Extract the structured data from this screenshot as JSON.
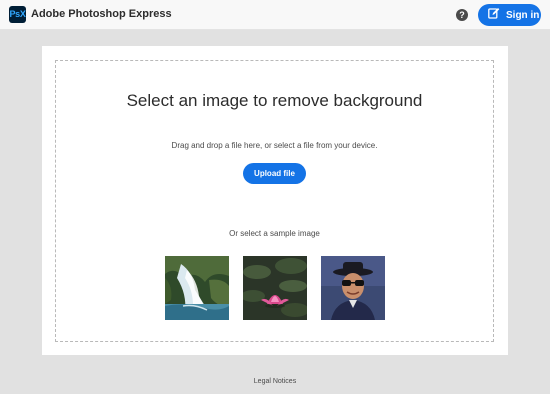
{
  "header": {
    "logo_text": "PsX",
    "app_title": "Adobe Photoshop Express",
    "help_glyph": "?",
    "help_icon": "help-icon",
    "signin_icon": "signin-icon",
    "signin_label": "Sign in"
  },
  "main": {
    "heading": "Select an image to remove background",
    "subtext": "Drag and drop a file here, or select a file from your device.",
    "upload_label": "Upload file",
    "sample_label": "Or select a sample image",
    "samples": [
      {
        "subject": "waterfall"
      },
      {
        "subject": "pink lotus flower"
      },
      {
        "subject": "man with sunglasses and hat"
      }
    ]
  },
  "footer": {
    "legal_label": "Legal Notices"
  },
  "colors": {
    "accent": "#1473e6",
    "page_bg": "#e1e1e1",
    "panel_bg": "#ffffff",
    "logo_bg": "#001e36",
    "logo_text": "#31a8ff"
  }
}
